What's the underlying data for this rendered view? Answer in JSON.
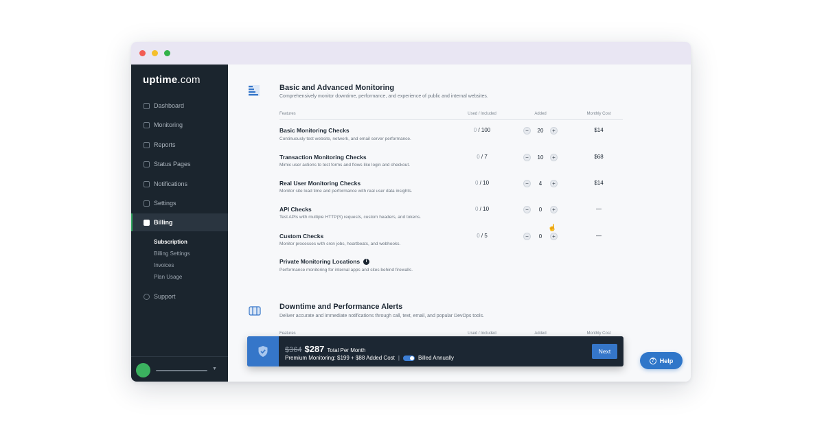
{
  "app": {
    "logo_main": "uptime",
    "logo_suffix": ".com"
  },
  "sidebar": {
    "items": [
      {
        "label": "Dashboard",
        "icon": "dashboard-icon"
      },
      {
        "label": "Monitoring",
        "icon": "chart-icon"
      },
      {
        "label": "Reports",
        "icon": "reports-icon"
      },
      {
        "label": "Status Pages",
        "icon": "flag-icon"
      },
      {
        "label": "Notifications",
        "icon": "bell-icon"
      },
      {
        "label": "Settings",
        "icon": "settings-icon"
      },
      {
        "label": "Billing",
        "icon": "credit-card-icon",
        "active": true
      },
      {
        "label": "Support",
        "icon": "globe-icon"
      }
    ],
    "billing_sub": [
      {
        "label": "Subscription",
        "active": true
      },
      {
        "label": "Billing Settings"
      },
      {
        "label": "Invoices"
      },
      {
        "label": "Plan Usage"
      }
    ]
  },
  "section1": {
    "title": "Basic and Advanced Monitoring",
    "desc": "Comprehensively monitor downtime, performance, and experience of public and internal websites.",
    "headers": {
      "features": "Features",
      "used": "Used / Included",
      "added": "Added",
      "cost": "Monthly Cost"
    },
    "rows": [
      {
        "name": "Basic Monitoring Checks",
        "desc": "Continuously test website, network, and email server performance.",
        "used": "0",
        "included": "/ 100",
        "added": "20",
        "cost": "$14"
      },
      {
        "name": "Transaction Monitoring Checks",
        "desc": "Mimic user actions to test forms and flows like login and checkout.",
        "used": "0",
        "included": "/ 7",
        "added": "10",
        "cost": "$68"
      },
      {
        "name": "Real User Monitoring Checks",
        "desc": "Monitor site load time and performance with real user data insights.",
        "used": "0",
        "included": "/ 10",
        "added": "4",
        "cost": "$14"
      },
      {
        "name": "API Checks",
        "desc": "Test APIs with multiple HTTP(S) requests, custom headers, and tokens.",
        "used": "0",
        "included": "/ 10",
        "added": "0",
        "cost": "—"
      },
      {
        "name": "Custom Checks",
        "desc": "Monitor processes with cron jobs, heartbeats, and webhooks.",
        "used": "0",
        "included": "/ 5",
        "added": "0",
        "cost": "—"
      }
    ],
    "private": {
      "name": "Private Monitoring Locations",
      "desc": "Performance monitoring for internal apps and sites behind firewalls."
    }
  },
  "section2": {
    "title": "Downtime and Performance Alerts",
    "desc": "Deliver accurate and immediate notifications through call, text, email, and popular DevOps tools.",
    "headers": {
      "features": "Features",
      "used": "Used / Included",
      "added": "Added",
      "cost": "Monthly Cost"
    }
  },
  "stepper": {
    "minus": "−",
    "plus": "+"
  },
  "summary": {
    "old_price": "$364",
    "new_price": "$287",
    "price_label": "Total Per Month",
    "detail": "Premium Monitoring: $199 + $88 Added Cost",
    "separator": "|",
    "billing": "Billed Annually",
    "next": "Next"
  },
  "help": {
    "label": "Help",
    "icon_glyph": "?"
  },
  "colors": {
    "accent": "#3576c9",
    "sidebar": "#1b252e",
    "active_marker": "#2fa55d"
  }
}
